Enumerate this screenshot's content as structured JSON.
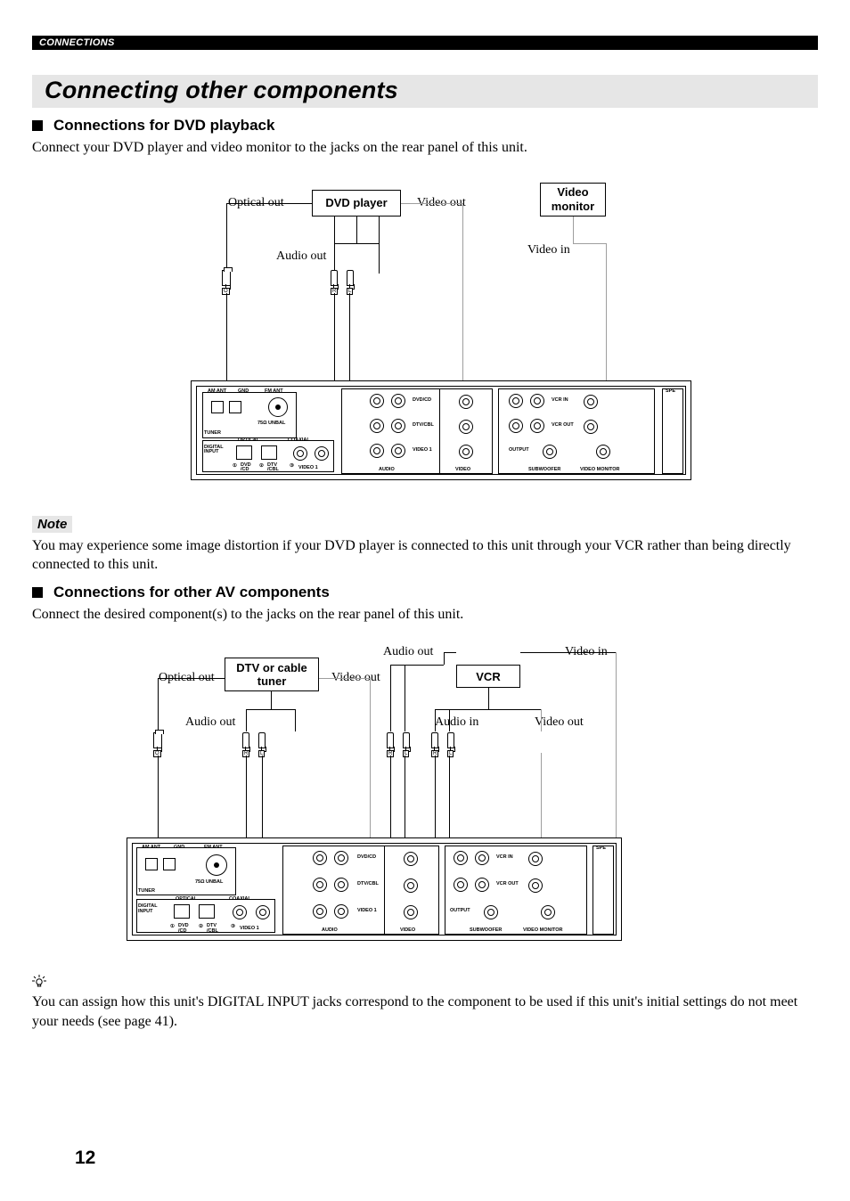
{
  "header": {
    "section": "CONNECTIONS"
  },
  "title": "Connecting other components",
  "sect1": {
    "heading": "Connections for DVD playback",
    "intro": "Connect your DVD player and video monitor to the jacks on the rear panel of this unit.",
    "labels": {
      "optical_out": "Optical out",
      "dvd_player": "DVD player",
      "video_out": "Video out",
      "video_monitor": "Video\nmonitor",
      "audio_out": "Audio out",
      "video_in": "Video in"
    }
  },
  "note": {
    "label": "Note",
    "text": "You may experience some image distortion if your DVD player is connected to this unit through your VCR rather than being directly connected to this unit."
  },
  "sect2": {
    "heading": "Connections for other AV components",
    "intro": "Connect the desired component(s) to the jacks on the rear panel of this unit.",
    "labels": {
      "optical_out": "Optical out",
      "dtv": "DTV or cable\ntuner",
      "video_out": "Video out",
      "audio_out1": "Audio out",
      "audio_out2": "Audio out",
      "vcr": "VCR",
      "video_in": "Video in",
      "audio_in": "Audio in",
      "video_out2": "Video out"
    }
  },
  "panel": {
    "tuner": "TUNER",
    "am_ant": "AM ANT",
    "gnd": "GND",
    "fm_ant": "FM ANT",
    "unbal": "75Ω UNBAL",
    "digital_input": "DIGITAL\nINPUT",
    "optical": "OPTICAL",
    "coaxial": "COAXIAL",
    "dvd_cd_num": "DVD\n/CD",
    "dtv_cbl_num": "DTV\n/CBL",
    "video1_num": "VIDEO 1",
    "dvd_cd": "DVD/CD",
    "dtv_cbl": "DTV/CBL",
    "video1": "VIDEO 1",
    "audio": "AUDIO",
    "video": "VIDEO",
    "vcr_in": "VCR IN",
    "vcr_out": "VCR OUT",
    "output": "OUTPUT",
    "subwoofer": "SUBWOOFER",
    "video_monitor": "VIDEO MONITOR",
    "spe": "SPE",
    "r": "R",
    "l": "L",
    "num1": "1",
    "num2": "2",
    "num3": "3",
    "o_tag": "O"
  },
  "hint": {
    "text": "You can assign how this unit's DIGITAL INPUT jacks correspond to the component to be used if this unit's initial settings do not meet your needs (see page 41)."
  },
  "page_number": "12"
}
